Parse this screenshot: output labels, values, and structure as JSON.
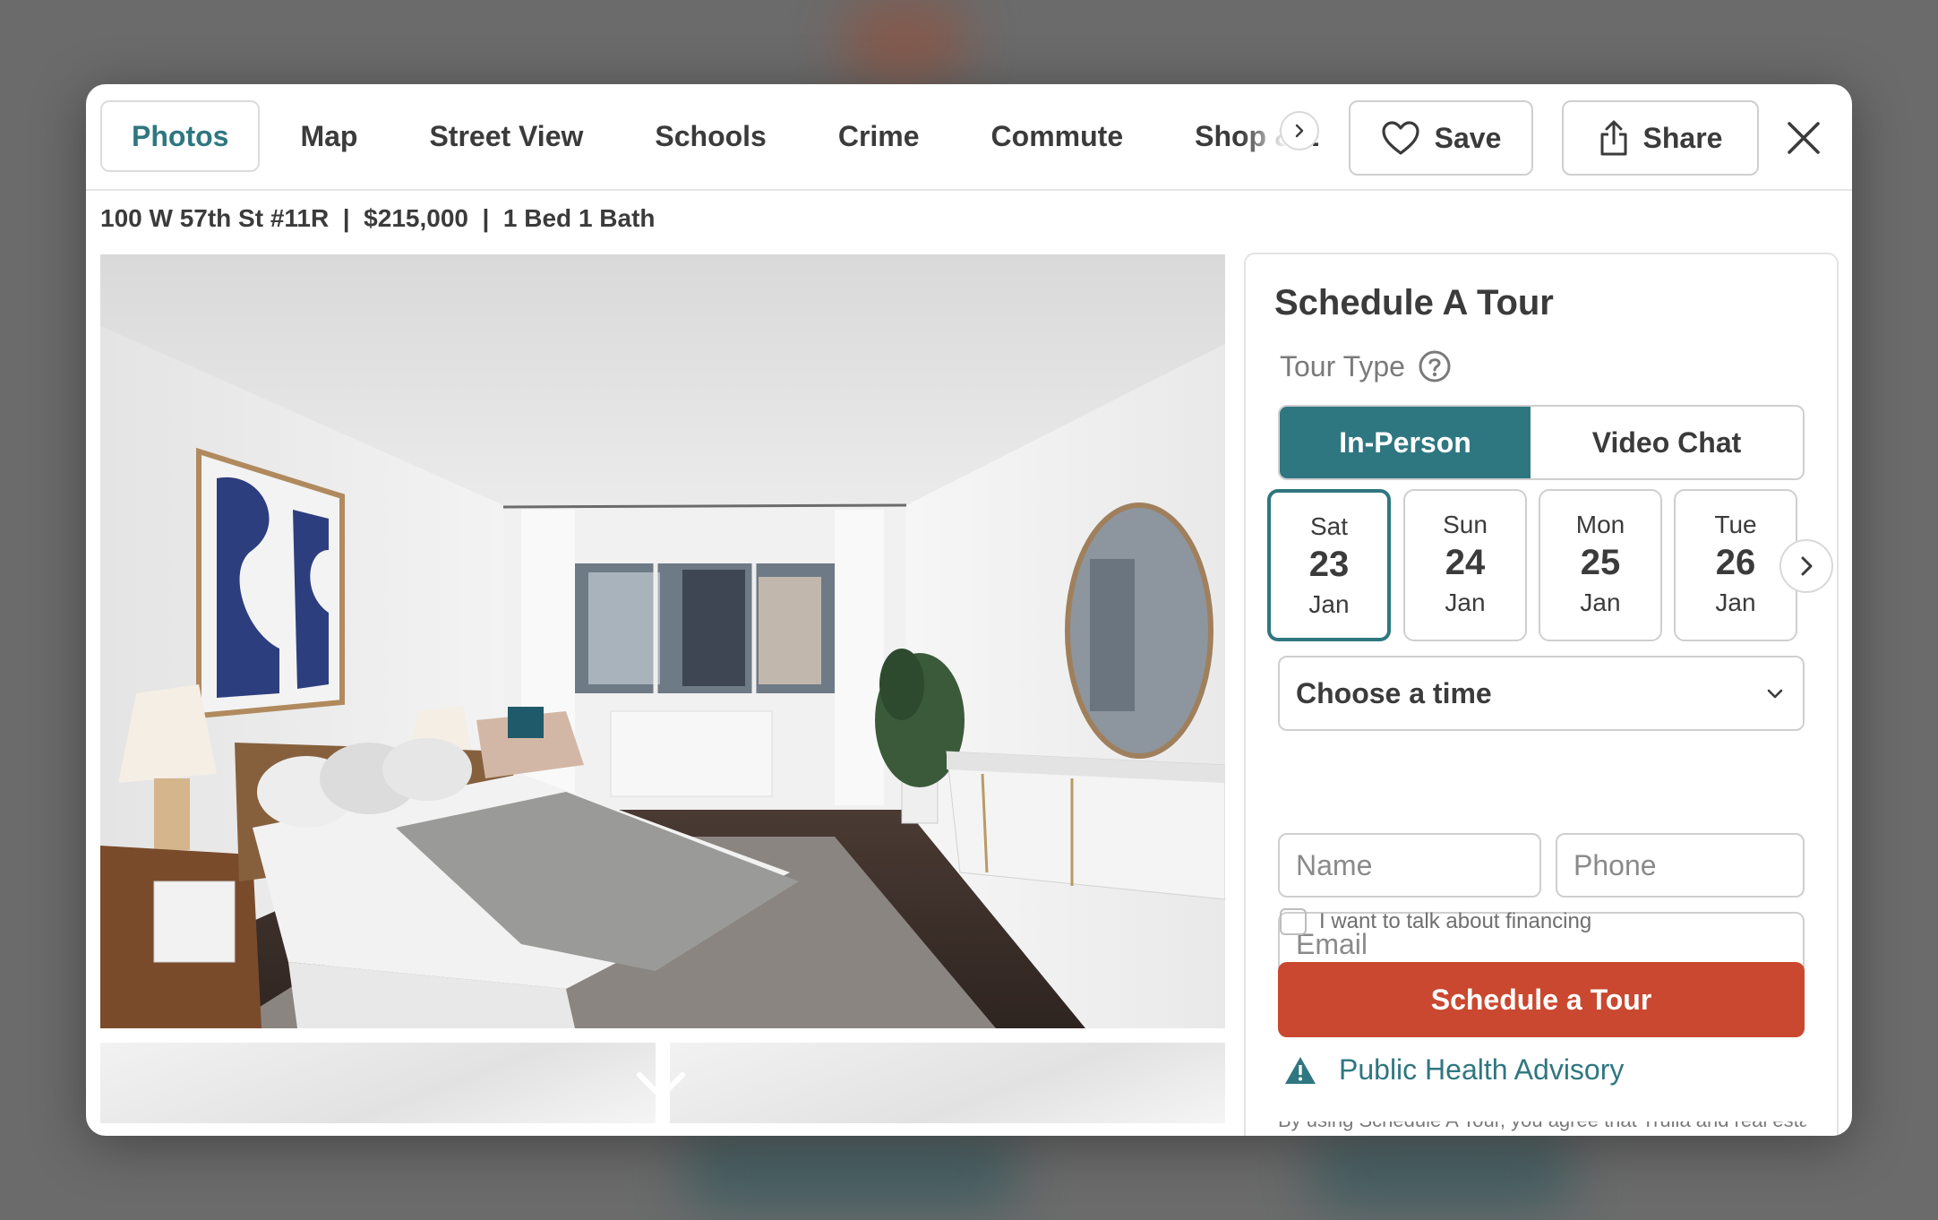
{
  "nav": {
    "tabs": [
      {
        "label": "Photos",
        "active": true
      },
      {
        "label": "Map"
      },
      {
        "label": "Street View"
      },
      {
        "label": "Schools"
      },
      {
        "label": "Crime"
      },
      {
        "label": "Commute"
      },
      {
        "label": "Shop & E"
      }
    ],
    "save_label": "Save",
    "share_label": "Share",
    "icons": [
      "chevron-right-icon",
      "heart-icon",
      "share-icon",
      "close-icon"
    ]
  },
  "listing": {
    "summary": "100 W 57th St #11R  |  $215,000  |  1 Bed 1 Bath"
  },
  "schedule": {
    "title": "Schedule A Tour",
    "tour_type_label": "Tour Type",
    "tour_types": [
      "In-Person",
      "Video Chat"
    ],
    "selected_tour_type": "In-Person",
    "dates": [
      {
        "weekday": "Sat",
        "day": "23",
        "month": "Jan",
        "selected": true
      },
      {
        "weekday": "Sun",
        "day": "24",
        "month": "Jan"
      },
      {
        "weekday": "Mon",
        "day": "25",
        "month": "Jan"
      },
      {
        "weekday": "Tue",
        "day": "26",
        "month": "Jan"
      }
    ],
    "time_select": "Choose a time",
    "name_placeholder": "Name",
    "phone_placeholder": "Phone",
    "email_placeholder": "Email",
    "financing_label": "I want to talk about financing",
    "financing_checked": false,
    "cta_label": "Schedule a Tour",
    "advisory_label": "Public Health Advisory",
    "advisory_text": "By using Schedule A Tour, you agree that Trulia and real estate"
  },
  "colors": {
    "accent": "#2f7780",
    "cta": "#c9482f",
    "backdrop": "#6b6b6b"
  }
}
